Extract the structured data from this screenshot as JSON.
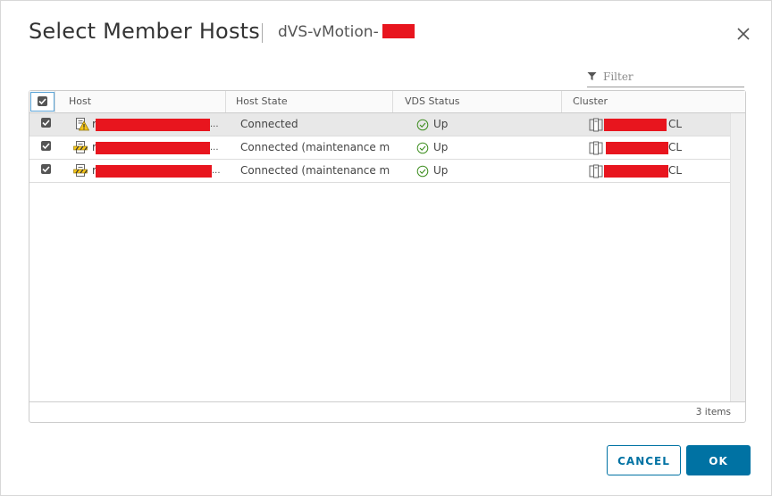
{
  "dialog": {
    "title": "Select Member Hosts",
    "subtitle": "dVS-vMotion-"
  },
  "filter": {
    "placeholder": "Filter"
  },
  "table": {
    "columns": [
      "Host",
      "Host State",
      "VDS Status",
      "Cluster"
    ],
    "rows": [
      {
        "host_prefix": "r",
        "host_suffix": "...",
        "host_icon": "host-warning-icon",
        "state": "Connected",
        "vds_status": "Up",
        "cluster_suffix": "CL",
        "checked": true,
        "selected": true
      },
      {
        "host_prefix": "r",
        "host_suffix": "...",
        "host_icon": "host-maintenance-icon",
        "state": "Connected (maintenance m...",
        "vds_status": "Up",
        "cluster_suffix": "CL",
        "checked": true,
        "selected": false
      },
      {
        "host_prefix": "r",
        "host_suffix": "...",
        "host_icon": "host-maintenance-icon",
        "state": "Connected (maintenance m...",
        "vds_status": "Up",
        "cluster_suffix": "CL",
        "checked": true,
        "selected": false
      }
    ],
    "footer_count": "3 items"
  },
  "buttons": {
    "cancel": "CANCEL",
    "ok": "OK"
  },
  "colors": {
    "accent": "#0072a3",
    "redaction": "#e8151e",
    "status_ok": "#3c8d1e",
    "warning": "#f5c518"
  }
}
